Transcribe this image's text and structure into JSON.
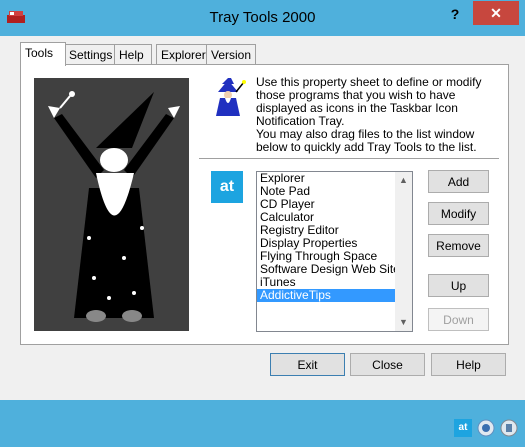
{
  "window": {
    "title": "Tray Tools 2000",
    "help_label": "?",
    "close_label": "✕"
  },
  "tabs": [
    {
      "label": "Tools",
      "active": true
    },
    {
      "label": "Settings"
    },
    {
      "label": "Help"
    },
    {
      "label": "Explorer"
    },
    {
      "label": "Version"
    }
  ],
  "description": {
    "line1": "Use this property sheet to define or modify those programs that you wish to have displayed as icons in the Taskbar Icon Notification Tray.",
    "line2": "You may also drag files to the list window below to quickly add Tray Tools to the list."
  },
  "logo_text": "at",
  "tools_list": {
    "items": [
      "Explorer",
      "Note Pad",
      "CD Player",
      "Calculator",
      "Registry Editor",
      "Display Properties",
      "Flying Through Space",
      "Software Design Web Site",
      "iTunes",
      "AddictiveTips"
    ],
    "selected": "AddictiveTips"
  },
  "side_buttons": {
    "add": "Add",
    "modify": "Modify",
    "remove": "Remove",
    "up": "Up",
    "down": "Down"
  },
  "bottom_buttons": {
    "exit": "Exit",
    "close": "Close",
    "help": "Help"
  },
  "taskbar": {
    "tray_at": "at"
  },
  "colors": {
    "titlebar": "#4fb0dc",
    "close": "#c7473e",
    "selection": "#3399ff",
    "logo": "#1da4e0"
  }
}
